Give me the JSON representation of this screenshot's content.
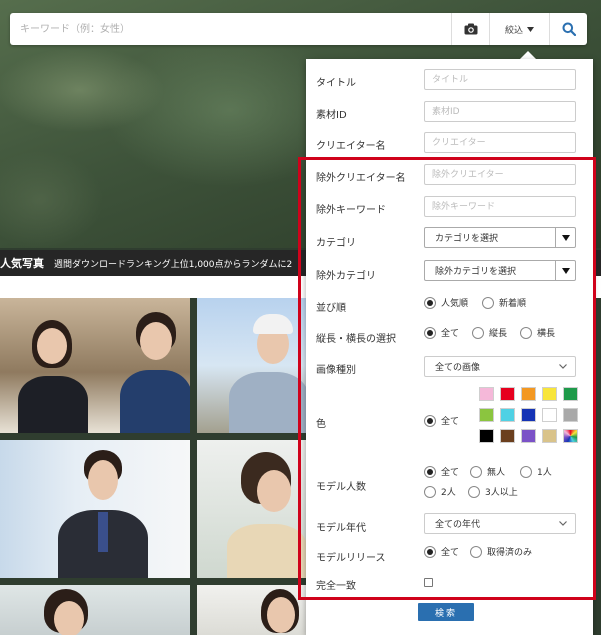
{
  "search": {
    "placeholder": "キーワード（例：女性）",
    "filter_label": "絞込",
    "camera_icon": "camera-icon",
    "search_icon": "search-icon"
  },
  "section": {
    "title": "人気写真",
    "subtitle": "週間ダウンロードランキング上位1,000点からランダムに2"
  },
  "panel": {
    "title_label": "タイトル",
    "title_placeholder": "タイトル",
    "material_id_label": "素材ID",
    "material_id_placeholder": "素材ID",
    "creator_label": "クリエイター名",
    "creator_placeholder": "クリエイター",
    "exclude_creator_label": "除外クリエイター名",
    "exclude_creator_placeholder": "除外クリエイター",
    "exclude_keyword_label": "除外キーワード",
    "exclude_keyword_placeholder": "除外キーワード",
    "category_label": "カテゴリ",
    "category_value": "カテゴリを選択",
    "exclude_category_label": "除外カテゴリ",
    "exclude_category_value": "除外カテゴリを選択",
    "sort_label": "並び順",
    "sort_options": [
      "人気順",
      "新着順"
    ],
    "sort_selected": 0,
    "orientation_label": "縦長・横長の選択",
    "orientation_options": [
      "全て",
      "縦長",
      "横長"
    ],
    "orientation_selected": 0,
    "image_type_label": "画像種別",
    "image_type_value": "全ての画像",
    "color_label": "色",
    "color_all_label": "全て",
    "colors": [
      "#f5b8d9",
      "#e6001e",
      "#f39822",
      "#f8e53a",
      "#1e9a4a",
      "#8bc53f",
      "#4fd1e4",
      "#1533b5",
      "#ffffff",
      "#a9a9a9",
      "#000000",
      "#6b3f1e",
      "#7b52c7",
      "#d9c38a",
      "multicolor"
    ],
    "model_count_label": "モデル人数",
    "model_count_options": [
      "全て",
      "無人",
      "1人",
      "2人",
      "3人以上"
    ],
    "model_count_selected": 0,
    "model_age_label": "モデル年代",
    "model_age_value": "全ての年代",
    "model_release_label": "モデルリリース",
    "model_release_options": [
      "全て",
      "取得済のみ"
    ],
    "model_release_selected": 0,
    "exact_match_label": "完全一致",
    "submit_label": "検索"
  },
  "accent_color": "#d0021b",
  "button_color": "#2a6fb0"
}
